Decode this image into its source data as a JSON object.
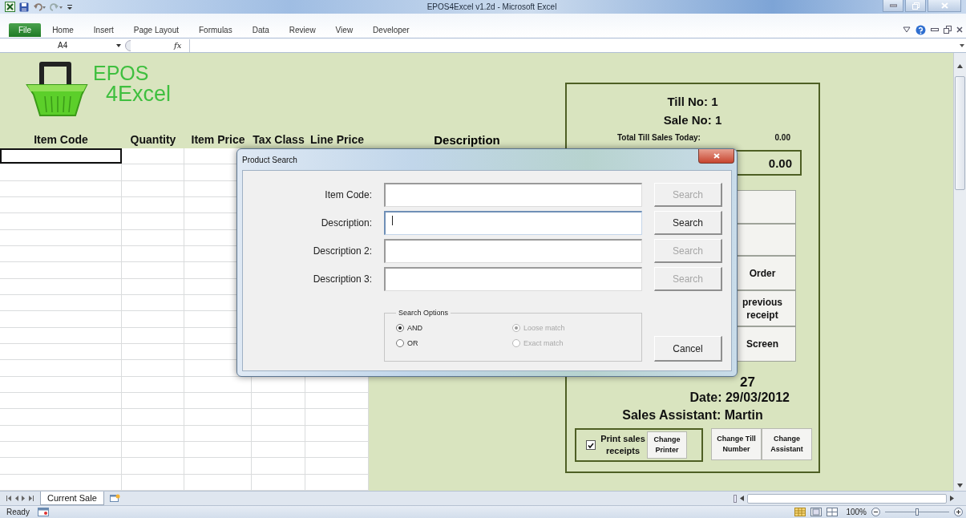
{
  "window": {
    "title": "EPOS4Excel v1.2d - Microsoft Excel"
  },
  "ribbon": {
    "file_tab": "File",
    "tabs": [
      "Home",
      "Insert",
      "Page Layout",
      "Formulas",
      "Data",
      "Review",
      "View",
      "Developer"
    ]
  },
  "formula_bar": {
    "name_box": "A4",
    "function_label": "fx"
  },
  "sheet": {
    "logo": {
      "line_1": "EPOS",
      "line_2": "4Excel"
    },
    "columns": [
      "Item Code",
      "Quantity",
      "Item Price",
      "Tax Class",
      "Line Price"
    ],
    "description_header": "Description",
    "rows": [
      {
        "selected": true
      },
      {
        "selected": false
      },
      {
        "selected": false
      },
      {
        "selected": false
      },
      {
        "selected": false
      },
      {
        "selected": false
      },
      {
        "selected": false
      },
      {
        "selected": false
      },
      {
        "selected": false
      },
      {
        "selected": false
      },
      {
        "selected": false
      },
      {
        "selected": false
      },
      {
        "selected": false
      },
      {
        "selected": false
      },
      {
        "selected": false
      },
      {
        "selected": false
      },
      {
        "selected": false
      },
      {
        "selected": false
      },
      {
        "selected": false
      },
      {
        "selected": false
      },
      {
        "selected": false
      }
    ]
  },
  "till_panel": {
    "till_no": "Till No: 1",
    "sale_no": "Sale No: 1",
    "total_label": "Total Till Sales Today:",
    "total_value": "0.00",
    "sale_total": "0.00",
    "buttons": [
      {
        "kind": "blank"
      },
      {
        "kind": "blank"
      },
      {
        "kind": "label",
        "label": "Order"
      },
      {
        "kind": "label",
        "label": "previous receipt"
      },
      {
        "kind": "label",
        "label": "Screen"
      }
    ],
    "partial_text": "27",
    "date": "Date: 29/03/2012",
    "sales_assistant": "Sales Assistant: Martin",
    "print_receipts": {
      "label": "Print sales receipts",
      "checked": true
    },
    "change_printer": "Change Printer",
    "change_till": "Change Till Number",
    "change_assistant": "Change Assistant"
  },
  "dialog": {
    "title": "Product Search",
    "fields": [
      {
        "label": "Item Code:",
        "focused": false,
        "button": "Search",
        "button_disabled": true
      },
      {
        "label": "Description:",
        "focused": true,
        "button": "Search",
        "button_disabled": false
      },
      {
        "label": "Description 2:",
        "focused": false,
        "button": "Search",
        "button_disabled": true
      },
      {
        "label": "Description 3:",
        "focused": false,
        "button": "Search",
        "button_disabled": true
      }
    ],
    "search_options": {
      "title": "Search Options",
      "options": [
        {
          "label": "AND",
          "selected": true,
          "disabled": false
        },
        {
          "label": "OR",
          "selected": false,
          "disabled": false
        },
        {
          "label": "Loose match",
          "selected": true,
          "disabled": true
        },
        {
          "label": "Exact match",
          "selected": false,
          "disabled": true
        }
      ]
    },
    "cancel": "Cancel"
  },
  "sheet_tabs": [
    {
      "label": "Current Sale",
      "selected": true
    }
  ],
  "status_bar": {
    "status": "Ready",
    "zoom": "100%",
    "zoom_slider": {
      "level": 0.5
    }
  }
}
